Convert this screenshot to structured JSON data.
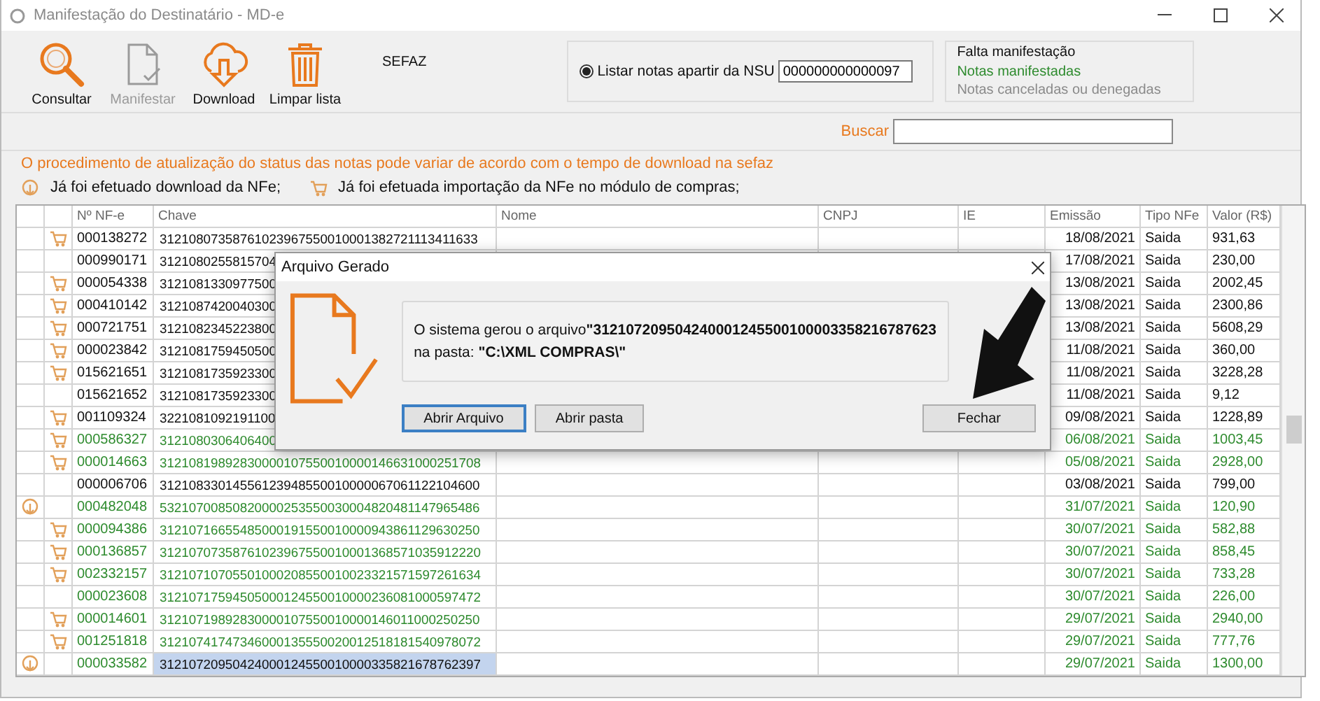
{
  "window": {
    "title": "Manifestação do Destinatário - MD-e"
  },
  "toolbar": {
    "buttons": [
      {
        "kind": "search",
        "label": "Consultar",
        "disabled": false
      },
      {
        "kind": "document",
        "label": "Manifestar",
        "disabled": true
      },
      {
        "kind": "cloud",
        "label": "Download",
        "disabled": false
      },
      {
        "kind": "trash",
        "label": "Limpar lista",
        "disabled": false
      }
    ],
    "section_label": "SEFAZ"
  },
  "nsu": {
    "option_label": "Listar notas apartir da NSU",
    "selected": true,
    "value": "000000000000097"
  },
  "legend_box": [
    {
      "text": "Falta manifestação",
      "color": "#111111"
    },
    {
      "text": "Notas manifestadas",
      "color": "#2e8b2e"
    },
    {
      "text": "Notas canceladas ou denegadas",
      "color": "#8a8a8a"
    }
  ],
  "search": {
    "label": "Buscar"
  },
  "notice": "O procedimento de atualização do status das notas pode variar de acordo com o tempo de download na sefaz",
  "icon_legend": [
    {
      "kind": "download",
      "text": "Já foi efetuado download da NFe;"
    },
    {
      "kind": "imported",
      "text": "Já foi efetuada importação da NFe no módulo de compras;"
    }
  ],
  "table": {
    "columns": [
      "Nº NF-e",
      "Chave",
      "Nome",
      "CNPJ",
      "IE",
      "Emissão",
      "Tipo NFe",
      "Valor (R$)"
    ],
    "rows": [
      {
        "download": false,
        "imported": true,
        "number": "000138272",
        "chave": "31210807358761023967550010001382721113411633",
        "emissao": "18/08/2021",
        "tipo": "Saida",
        "valor": "931,63",
        "manifested": false,
        "selected": false
      },
      {
        "download": false,
        "imported": false,
        "number": "000990171",
        "chave": "3121080255815704",
        "emissao": "17/08/2021",
        "tipo": "Saida",
        "valor": "230,00",
        "manifested": false,
        "selected": false
      },
      {
        "download": false,
        "imported": true,
        "number": "000054338",
        "chave": "3121081330977500",
        "emissao": "13/08/2021",
        "tipo": "Saida",
        "valor": "2002,45",
        "manifested": false,
        "selected": false
      },
      {
        "download": false,
        "imported": true,
        "number": "000410142",
        "chave": "3121087420040300",
        "emissao": "13/08/2021",
        "tipo": "Saida",
        "valor": "2300,86",
        "manifested": false,
        "selected": false
      },
      {
        "download": false,
        "imported": true,
        "number": "000721751",
        "chave": "3121082345223800",
        "emissao": "13/08/2021",
        "tipo": "Saida",
        "valor": "5608,29",
        "manifested": false,
        "selected": false
      },
      {
        "download": false,
        "imported": true,
        "number": "000023842",
        "chave": "3121081759450500",
        "emissao": "11/08/2021",
        "tipo": "Saida",
        "valor": "360,00",
        "manifested": false,
        "selected": false
      },
      {
        "download": false,
        "imported": true,
        "number": "015621651",
        "chave": "3121081735923300",
        "emissao": "11/08/2021",
        "tipo": "Saida",
        "valor": "3228,28",
        "manifested": false,
        "selected": false
      },
      {
        "download": false,
        "imported": false,
        "number": "015621652",
        "chave": "3121081735923300",
        "emissao": "11/08/2021",
        "tipo": "Saida",
        "valor": "9,12",
        "manifested": false,
        "selected": false
      },
      {
        "download": false,
        "imported": true,
        "number": "001109324",
        "chave": "3221081092191100",
        "emissao": "09/08/2021",
        "tipo": "Saida",
        "valor": "1228,89",
        "manifested": false,
        "selected": false
      },
      {
        "download": false,
        "imported": true,
        "number": "000586327",
        "chave": "3121080306406400",
        "emissao": "06/08/2021",
        "tipo": "Saida",
        "valor": "1003,45",
        "manifested": true,
        "selected": false
      },
      {
        "download": false,
        "imported": true,
        "number": "000014663",
        "chave": "31210819892830000107550010000146631000251708",
        "emissao": "05/08/2021",
        "tipo": "Saida",
        "valor": "2928,00",
        "manifested": true,
        "selected": false
      },
      {
        "download": false,
        "imported": false,
        "number": "000006706",
        "chave": "31210833014556123948550010000067061122104600",
        "emissao": "03/08/2021",
        "tipo": "Saida",
        "valor": "799,00",
        "manifested": false,
        "selected": false
      },
      {
        "download": true,
        "imported": false,
        "number": "000482048",
        "chave": "53210700850820000253550030004820481147965486",
        "emissao": "31/07/2021",
        "tipo": "Saida",
        "valor": "120,90",
        "manifested": true,
        "selected": false
      },
      {
        "download": false,
        "imported": true,
        "number": "000094386",
        "chave": "31210716655485000191550010000943861129630250",
        "emissao": "30/07/2021",
        "tipo": "Saida",
        "valor": "582,88",
        "manifested": true,
        "selected": false
      },
      {
        "download": false,
        "imported": true,
        "number": "000136857",
        "chave": "31210707358761023967550010001368571035912220",
        "emissao": "30/07/2021",
        "tipo": "Saida",
        "valor": "858,45",
        "manifested": true,
        "selected": false
      },
      {
        "download": false,
        "imported": true,
        "number": "002332157",
        "chave": "31210710705501000208550010023321571597261634",
        "emissao": "30/07/2021",
        "tipo": "Saida",
        "valor": "733,28",
        "manifested": true,
        "selected": false
      },
      {
        "download": false,
        "imported": false,
        "number": "000023608",
        "chave": "31210717594505000124550010000236081000597472",
        "emissao": "30/07/2021",
        "tipo": "Saida",
        "valor": "226,00",
        "manifested": true,
        "selected": false
      },
      {
        "download": false,
        "imported": true,
        "number": "000014601",
        "chave": "31210719892830000107550010000146011000250250",
        "emissao": "29/07/2021",
        "tipo": "Saida",
        "valor": "2940,00",
        "manifested": true,
        "selected": false
      },
      {
        "download": false,
        "imported": true,
        "number": "001251818",
        "chave": "31210741747346000135550020012518181540978072",
        "emissao": "29/07/2021",
        "tipo": "Saida",
        "valor": "777,76",
        "manifested": true,
        "selected": false
      },
      {
        "download": true,
        "imported": false,
        "number": "000033582",
        "chave": "31210720950424000124550010000335821678762397",
        "emissao": "29/07/2021",
        "tipo": "Saida",
        "valor": "1300,00",
        "manifested": true,
        "selected": true
      }
    ]
  },
  "dialog": {
    "title": "Arquivo Gerado",
    "message_lines": [
      "O sistema gerou o arquivo**\"312107209504240001245500100003358216787623**",
      "na pasta: **\"C:\\XML COMPRAS\\\"**"
    ],
    "buttons": [
      {
        "label": "Abrir Arquivo",
        "focused": true
      },
      {
        "label": "Abrir pasta",
        "focused": false
      },
      {
        "label": "Fechar",
        "focused": false
      }
    ]
  }
}
